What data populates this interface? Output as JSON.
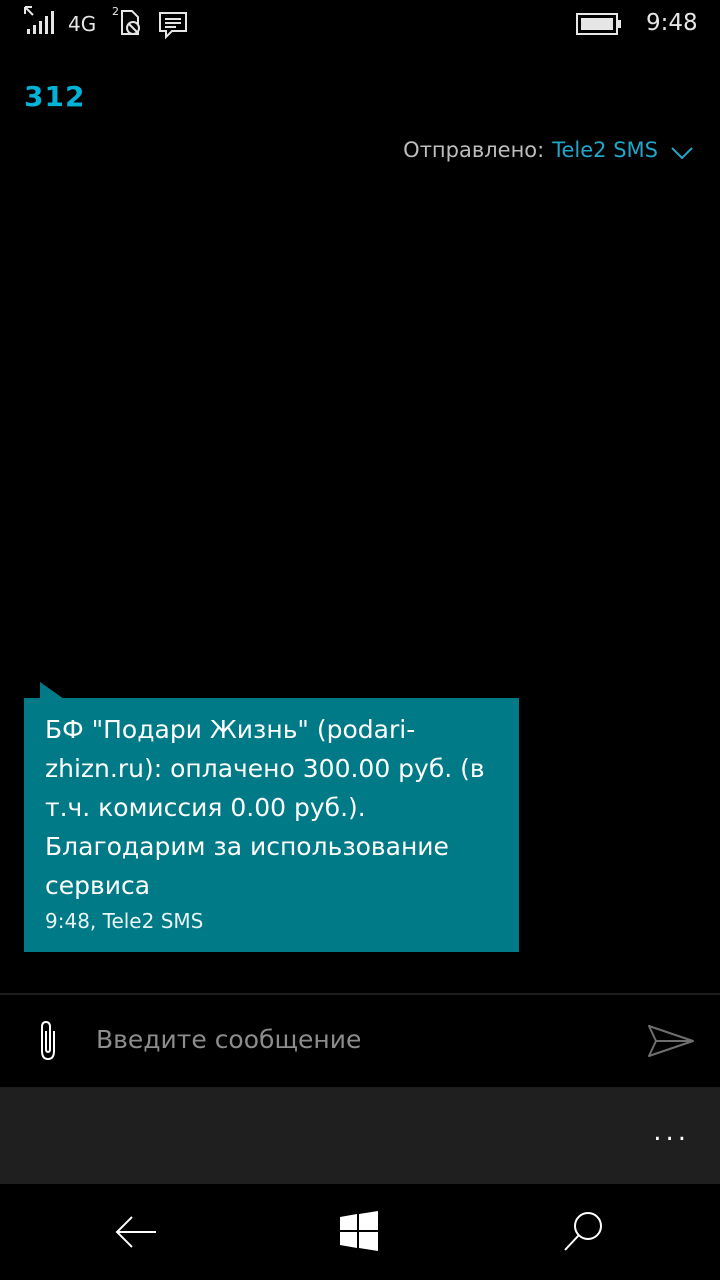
{
  "status_bar": {
    "network": "4G",
    "time": "9:48",
    "icons": [
      "signal-icon",
      "sim-icon",
      "message-notification-icon",
      "battery-icon"
    ]
  },
  "conversation": {
    "contact": "312",
    "sent_label": "Отправлено:",
    "sent_value": "Tele2 SMS"
  },
  "message": {
    "text": "БФ \"Подари Жизнь\" (podari-\nzhizn.ru): оплачено 300.00 руб. (в\nт.ч. комиссия 0.00 руб.).\nБлагодарим за использование\nсервиса",
    "meta": "9:48, Tele2 SMS"
  },
  "compose": {
    "placeholder": "Введите сообщение",
    "value": ""
  },
  "app_bar": {
    "more_label": "..."
  },
  "colors": {
    "accent": "#22a5c8",
    "bubble": "#007a87",
    "background": "#000000",
    "app_bar": "#1f1f1f"
  }
}
